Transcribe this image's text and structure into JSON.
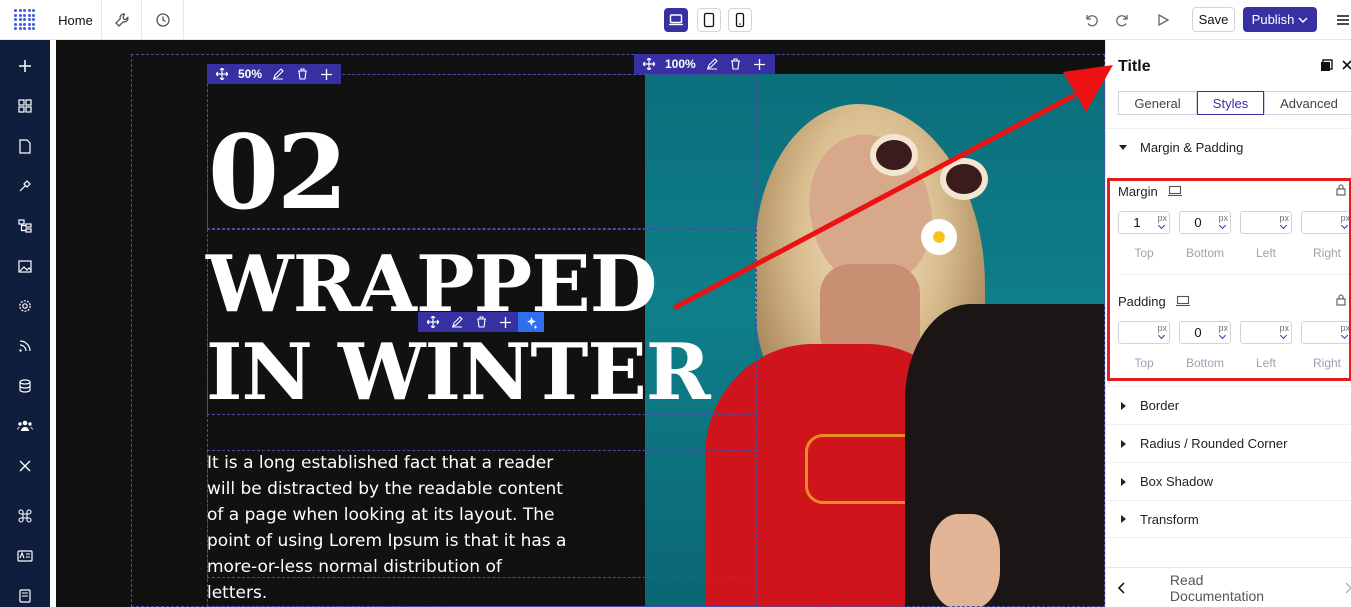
{
  "topbar": {
    "home_label": "Home",
    "save_label": "Save",
    "publish_label": "Publish",
    "active_device": "desktop"
  },
  "canvas": {
    "toolbar_section_pct": "50%",
    "toolbar_column_pct": "100%",
    "title_number": "02",
    "title_line1": "WRAPPED",
    "title_line2": "IN WINTER",
    "paragraph": "It is a long established fact that a reader will be distracted by the readable content of a page when looking at its layout. The point of using Lorem Ipsum is that it has a more-or-less normal distribution of letters."
  },
  "panel": {
    "title": "Title",
    "tabs": [
      "General",
      "Styles",
      "Advanced"
    ],
    "active_tab": "Styles",
    "open_section": "Margin & Padding",
    "margin": {
      "label": "Margin",
      "top": "1",
      "bottom": "0",
      "left": "",
      "right": "",
      "unit": "px"
    },
    "padding": {
      "label": "Padding",
      "top": "",
      "bottom": "0",
      "left": "",
      "right": "",
      "unit": "px"
    },
    "side_labels": [
      "Top",
      "Bottom",
      "Left",
      "Right"
    ],
    "sections": [
      "Border",
      "Radius / Rounded Corner",
      "Box Shadow",
      "Transform"
    ],
    "footer_label": "Read Documentation"
  },
  "colors": {
    "accent": "#3730a3",
    "sidebar_bg": "#0f1e3d",
    "canvas_bg": "#111112",
    "annotation": "#e11d1d"
  }
}
